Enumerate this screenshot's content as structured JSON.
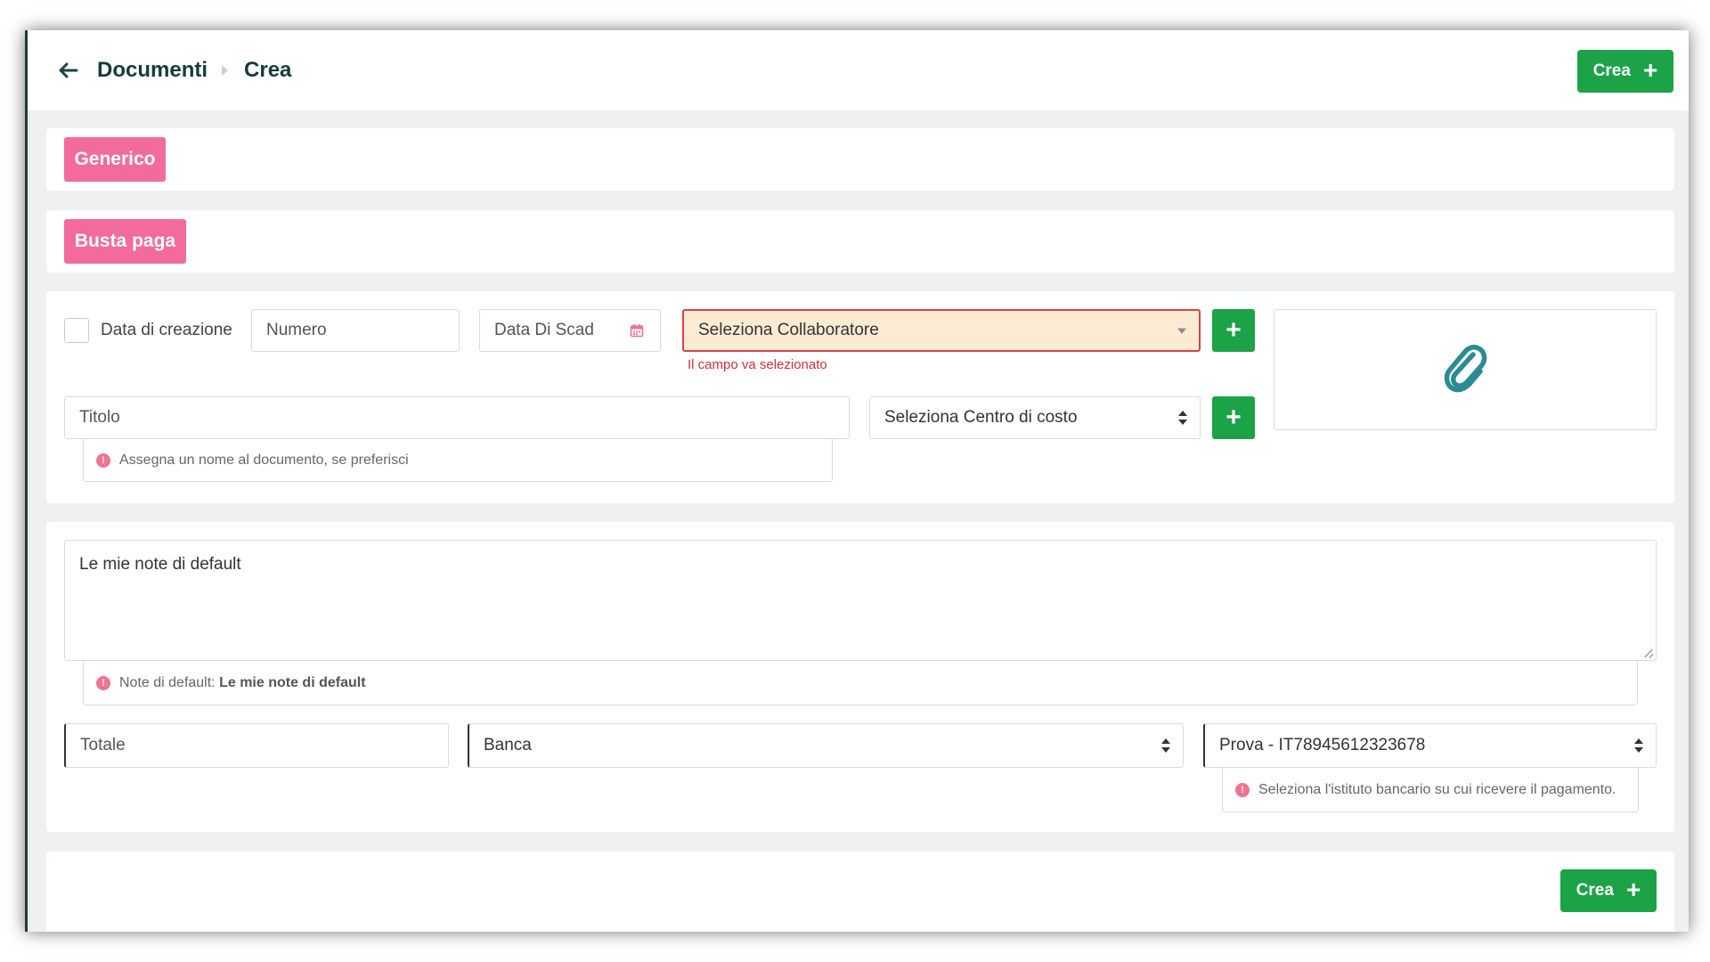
{
  "header": {
    "breadcrumb": [
      "Documenti",
      "Crea"
    ],
    "create_label": "Crea",
    "create_icon": "plus-icon"
  },
  "types": {
    "generic_label": "Generico",
    "payslip_label": "Busta paga",
    "accent_color": "#f26b9c"
  },
  "form": {
    "creation_date_label": "Data di creazione",
    "number_placeholder": "Numero",
    "due_date_placeholder": "Data Di Scad",
    "collaborator_select": "Seleziona Collaboratore",
    "collaborator_error": "Il campo va selezionato",
    "title_placeholder": "Titolo",
    "title_hint": "Assegna un nome al documento, se preferisci",
    "cost_center_select": "Seleziona Centro di costo",
    "attach_icon": "paperclip-icon"
  },
  "notes": {
    "value": "Le mie note di default",
    "hint_prefix": "Note di default:",
    "hint_value": "Le mie note di default"
  },
  "payment": {
    "total_placeholder": "Totale",
    "method_select": "Banca",
    "bank_account_select": "Prova - IT78945612323678",
    "bank_hint": "Seleziona l'istituto bancario su cui ricevere il pagamento."
  },
  "footer": {
    "create_label": "Crea"
  },
  "colors": {
    "primary_green": "#1ca247",
    "error_red": "#d9424c",
    "header_text": "#173a3c"
  }
}
